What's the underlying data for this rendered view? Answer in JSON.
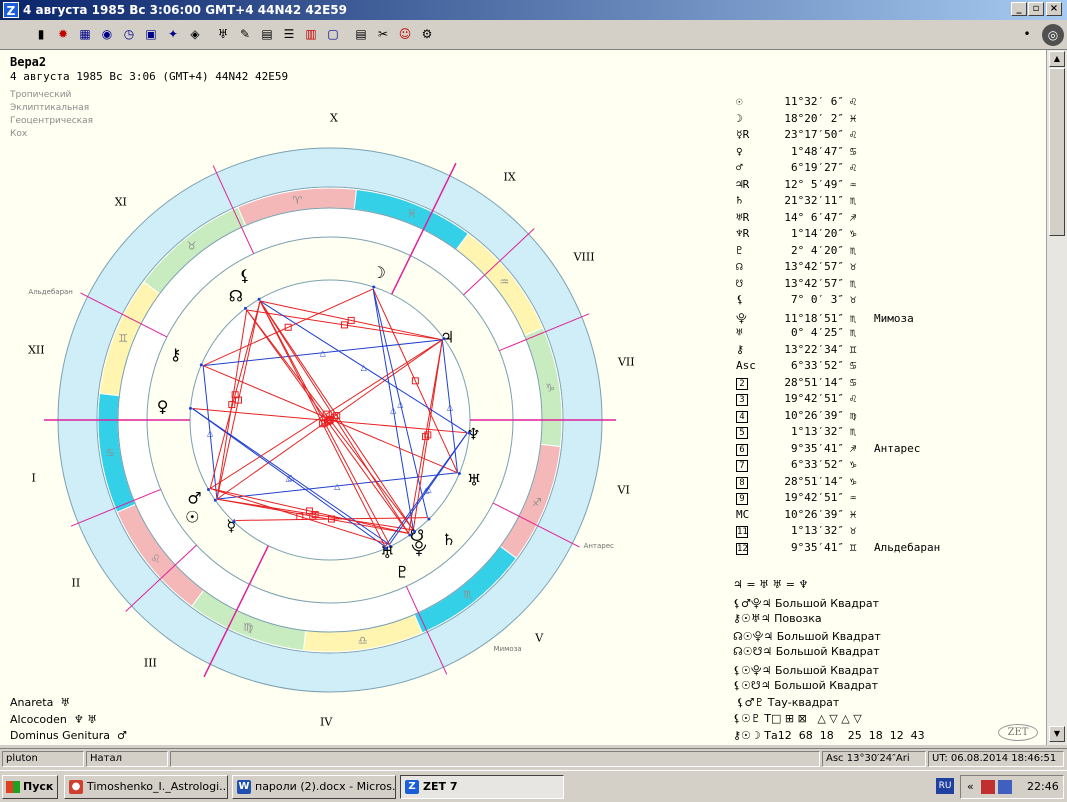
{
  "window": {
    "logo": "Z",
    "title": "4 августа 1985  Вс   3:06:00 GMT+4 44N42  42E59",
    "minimize": "_",
    "maximize": "▫",
    "close": "×",
    "toolbar_right_sym": "•"
  },
  "toolbar": [
    {
      "name": "calendar-icon",
      "glyph": "▮",
      "color": "normal"
    },
    {
      "name": "fire-icon",
      "glyph": "✹",
      "color": "red"
    },
    {
      "name": "grid-icon",
      "glyph": "▦",
      "color": "blue"
    },
    {
      "name": "globe-icon",
      "glyph": "◉",
      "color": "blue"
    },
    {
      "name": "clock-icon",
      "glyph": "◷",
      "color": "blue"
    },
    {
      "name": "map-icon",
      "glyph": "▣",
      "color": "blue"
    },
    {
      "name": "stars-icon",
      "glyph": "✦",
      "color": "blue"
    },
    {
      "name": "planet-icon",
      "glyph": "◈",
      "color": "normal"
    },
    {
      "name": "aspect-icon",
      "glyph": "♅",
      "color": "normal"
    },
    {
      "name": "pen-icon",
      "glyph": "✎",
      "color": "normal"
    },
    {
      "name": "table-icon",
      "glyph": "▤",
      "color": "normal"
    },
    {
      "name": "list-icon",
      "glyph": "☰",
      "color": "normal"
    },
    {
      "name": "ephemeris-icon",
      "glyph": "▥",
      "color": "red"
    },
    {
      "name": "graph-icon",
      "glyph": "▢",
      "color": "blue"
    },
    {
      "name": "document-icon",
      "glyph": "▤",
      "color": "normal"
    },
    {
      "name": "tools-icon",
      "glyph": "✂",
      "color": "normal"
    },
    {
      "name": "person-icon",
      "glyph": "☺",
      "color": "red"
    },
    {
      "name": "settings-icon",
      "glyph": "⚙",
      "color": "normal"
    }
  ],
  "header": {
    "name": "Вера2",
    "date": "4 августа 1985  Вс   3:06 (GMT+4) 44N42  42E59",
    "system": [
      "Тропический",
      "Эклиптикальная",
      "Геоцентрическая",
      "Кох"
    ]
  },
  "chart_data": {
    "type": "table",
    "houses_roman": [
      "I",
      "II",
      "III",
      "IV",
      "V",
      "VI",
      "VII",
      "VIII",
      "IX",
      "X",
      "XI",
      "XII"
    ],
    "fixed_stars": [
      "Альдебаран",
      "Антарес",
      "Мимоза"
    ],
    "positions": [
      {
        "sym": "☉",
        "deg": "11°32′ 6″",
        "sign": "♌",
        "star": ""
      },
      {
        "sym": "☽",
        "deg": "18°20′ 2″",
        "sign": "♓",
        "star": ""
      },
      {
        "sym": "☿R",
        "deg": "23°17′50″",
        "sign": "♌",
        "star": ""
      },
      {
        "sym": "♀",
        "deg": "1°48′47″",
        "sign": "♋",
        "star": ""
      },
      {
        "sym": "♂",
        "deg": "6°19′27″",
        "sign": "♌",
        "star": ""
      },
      {
        "sym": "♃R",
        "deg": "12° 5′49″",
        "sign": "♒",
        "star": ""
      },
      {
        "sym": "♄",
        "deg": "21°32′11″",
        "sign": "♏",
        "star": ""
      },
      {
        "sym": "♅R",
        "deg": "14° 6′47″",
        "sign": "♐",
        "star": ""
      },
      {
        "sym": "♆R",
        "deg": "1°14′20″",
        "sign": "♑",
        "star": ""
      },
      {
        "sym": "♇",
        "deg": "2° 4′20″",
        "sign": "♏",
        "star": ""
      },
      {
        "sym": "☊",
        "deg": "13°42′57″",
        "sign": "♉",
        "star": ""
      },
      {
        "sym": "☋",
        "deg": "13°42′57″",
        "sign": "♏",
        "star": ""
      },
      {
        "sym": "⚸",
        "deg": "7° 0′ 3″",
        "sign": "♉",
        "star": ""
      },
      {
        "sym": "⯓",
        "deg": "11°18′51″",
        "sign": "♏",
        "star": "Мимоза"
      },
      {
        "sym": "♅",
        "deg": "0° 4′25″",
        "sign": "♏",
        "star": ""
      },
      {
        "sym": "⚷",
        "deg": "13°22′34″",
        "sign": "♊",
        "star": ""
      },
      {
        "sym": "Asc",
        "deg": "6°33′52″",
        "sign": "♋",
        "star": ""
      },
      {
        "sym": "2",
        "deg": "28°51′14″",
        "sign": "♋",
        "star": ""
      },
      {
        "sym": "3",
        "deg": "19°42′51″",
        "sign": "♌",
        "star": ""
      },
      {
        "sym": "4",
        "deg": "10°26′39″",
        "sign": "♍",
        "star": ""
      },
      {
        "sym": "5",
        "deg": "1°13′32″",
        "sign": "♏",
        "star": ""
      },
      {
        "sym": "6",
        "deg": "9°35′41″",
        "sign": "♐",
        "star": "Антарес"
      },
      {
        "sym": "7",
        "deg": "6°33′52″",
        "sign": "♑",
        "star": ""
      },
      {
        "sym": "8",
        "deg": "28°51′14″",
        "sign": "♑",
        "star": ""
      },
      {
        "sym": "9",
        "deg": "19°42′51″",
        "sign": "♒",
        "star": ""
      },
      {
        "sym": "MC",
        "deg": "10°26′39″",
        "sign": "♓",
        "star": ""
      },
      {
        "sym": "11",
        "deg": "1°13′32″",
        "sign": "♉",
        "star": ""
      },
      {
        "sym": "12",
        "deg": "9°35′41″",
        "sign": "♊",
        "star": "Альдебаран"
      }
    ],
    "configurations": [
      {
        "syms": "♃ = ♅ ♅ = ♆",
        "label": ""
      },
      {
        "syms": "⚸♂⯓♃",
        "label": "Большой Квадрат"
      },
      {
        "syms": "⚷☉♅♃",
        "label": "Повозка"
      },
      {
        "syms": "☊☉⯓♃",
        "label": "Большой Квадрат"
      },
      {
        "syms": "☊☉☋♃",
        "label": "Большой Квадрат"
      },
      {
        "syms": "⚸☉⯓♃",
        "label": "Большой Квадрат"
      },
      {
        "syms": "⚸☉☋♃",
        "label": "Большой Квадрат"
      },
      {
        "syms": " ⚸♂♇",
        "label": "Тау-квадрат"
      },
      {
        "syms": "⚸☉♇ Т□ ⊞ ⊠",
        "label": "  △ ▽ △ ▽"
      },
      {
        "syms": "⚷☉☽ Та12  68  18",
        "label": "   25  18  12  43"
      }
    ],
    "bottom": [
      {
        "label": "Anareta",
        "value": "♅"
      },
      {
        "label": "Alcocoden",
        "value": "♆ ♅"
      },
      {
        "label": "Dominus Genitura",
        "value": "♂"
      }
    ]
  },
  "wheel": {
    "sign_glyphs": [
      "♈",
      "♉",
      "♊",
      "♋",
      "♌",
      "♍",
      "♎",
      "♏",
      "♐",
      "♑",
      "♒",
      "♓"
    ],
    "sign_colors": [
      "#f4b8b8",
      "#c8ecbf",
      "#fff5b0",
      "#33d0e8"
    ],
    "ring_color": "#cfeef8",
    "line_colors": [
      "#e82020",
      "#2040d0"
    ]
  },
  "statusbar": {
    "user": "pluton",
    "chart_type": "Натал",
    "asc": "Asc  13°30′24″Ari",
    "ut": "UT: 06.08.2014 18:46:51"
  },
  "taskbar": {
    "start": "Пуск",
    "tasks": [
      "Timoshenko_I._Astrologi...",
      "пароли (2).docx - Micros...",
      "ZET 7"
    ],
    "lang": "RU",
    "time": "22:46"
  },
  "watermark": "ZET"
}
